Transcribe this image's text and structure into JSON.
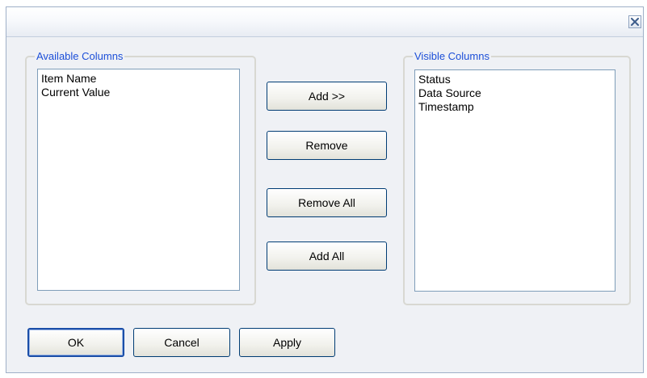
{
  "dialog": {
    "close_icon": "close-icon"
  },
  "available": {
    "legend": "Available Columns",
    "items": [
      "Item Name",
      "Current Value"
    ]
  },
  "visible": {
    "legend": "Visible Columns",
    "items": [
      "Status",
      "Data Source",
      "Timestamp"
    ]
  },
  "actions": {
    "add": "Add >>",
    "remove": "Remove",
    "remove_all": "Remove All",
    "add_all": "Add All"
  },
  "footer": {
    "ok": "OK",
    "cancel": "Cancel",
    "apply": "Apply"
  },
  "colors": {
    "legend": "#1c4fd8",
    "dialog_bg": "#eff1f5",
    "button_border": "#003c74"
  }
}
